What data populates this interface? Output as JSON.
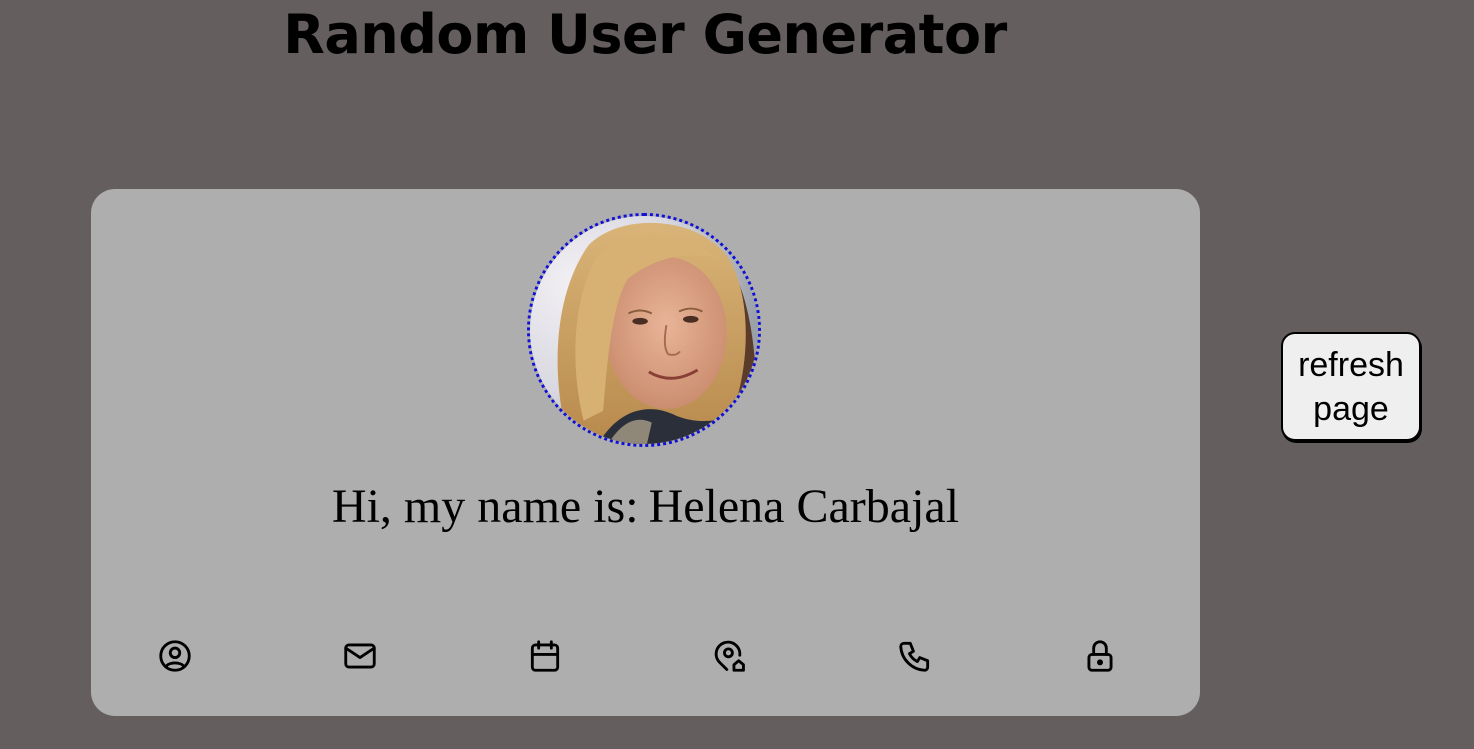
{
  "page": {
    "title": "Random User Generator"
  },
  "card": {
    "greeting_label": "Hi, my name is:",
    "value": "Helena Carbajal",
    "avatar_alt": "Helena Carbajal",
    "icons": [
      {
        "name": "user-icon"
      },
      {
        "name": "mail-icon"
      },
      {
        "name": "calendar-icon"
      },
      {
        "name": "map-pin-home-icon"
      },
      {
        "name": "phone-icon"
      },
      {
        "name": "lock-icon"
      }
    ]
  },
  "refresh": {
    "label": "refresh page"
  },
  "colors": {
    "background": "#645f5e",
    "card": "#aeaeae",
    "avatar_border": "#1010d8",
    "button": "#efefef"
  }
}
